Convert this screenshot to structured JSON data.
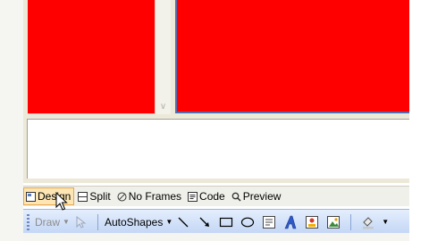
{
  "view_tabs": [
    {
      "label": "Design",
      "icon": "design-view-icon",
      "active": true
    },
    {
      "label": "Split",
      "icon": "split-view-icon",
      "active": false
    },
    {
      "label": "No Frames",
      "icon": "no-frames-icon",
      "active": false
    },
    {
      "label": "Code",
      "icon": "code-view-icon",
      "active": false
    },
    {
      "label": "Preview",
      "icon": "preview-icon",
      "active": false
    }
  ],
  "drawing_toolbar": {
    "draw_label": "Draw",
    "autoshapes_label": "AutoShapes",
    "tools": [
      "select-objects-icon",
      "line-icon",
      "arrow-icon",
      "rectangle-icon",
      "oval-icon",
      "text-box-icon",
      "wordart-icon",
      "diagram-icon",
      "clip-art-icon",
      "fill-color-icon"
    ]
  },
  "colors": {
    "frame_fill": "#ff0000",
    "frame_selection_border": "#4c6eb3",
    "active_tab_bg": "#fde6b4",
    "toolbar_gradient_top": "#e4eefd",
    "toolbar_gradient_bottom": "#c3d6f5"
  }
}
